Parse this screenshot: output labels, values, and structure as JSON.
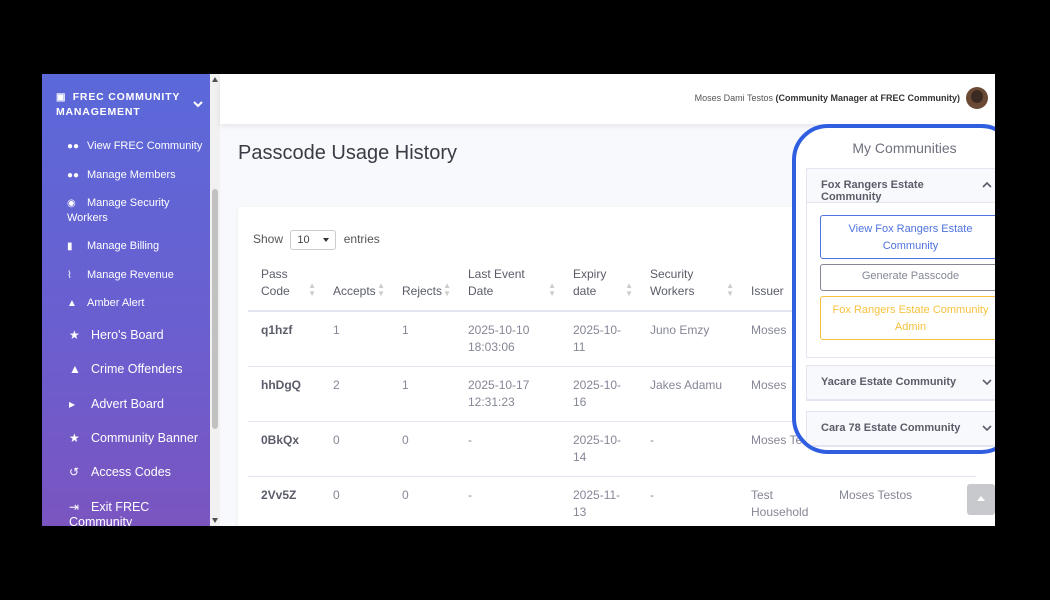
{
  "sidebar": {
    "brand": "FREC COMMUNITY MANAGEMENT",
    "items": [
      {
        "label": "View FREC Community",
        "icon": "users-icon",
        "glyph": "👥"
      },
      {
        "label": "Manage Members",
        "icon": "users-icon",
        "glyph": "👥"
      },
      {
        "label": "Manage Security Workers",
        "icon": "shield-icon",
        "glyph": "⛊"
      },
      {
        "label": "Manage Billing",
        "icon": "file-icon",
        "glyph": "▮"
      },
      {
        "label": "Manage Revenue",
        "icon": "chart-line-icon",
        "glyph": "⌇"
      },
      {
        "label": "Amber Alert",
        "icon": "warning-icon",
        "glyph": "▲"
      },
      {
        "label": "Hero's Board",
        "icon": "trophy-icon",
        "glyph": "🏆"
      },
      {
        "label": "Crime Offenders",
        "icon": "warning-icon",
        "glyph": "▲"
      },
      {
        "label": "Advert Board",
        "icon": "megaphone-icon",
        "glyph": "📢"
      },
      {
        "label": "Community Banner",
        "icon": "trophy-icon",
        "glyph": "🏆"
      },
      {
        "label": "Access Codes",
        "icon": "history-icon",
        "glyph": "↺"
      },
      {
        "label": "Exit FREC Community",
        "icon": "sign-out-icon",
        "glyph": "⇥"
      }
    ]
  },
  "topbar": {
    "user_name": "Moses Dami Testos",
    "user_role": "(Community Manager at FREC Community)"
  },
  "page": {
    "title": "Passcode Usage History"
  },
  "table": {
    "show_label": "Show",
    "entries_value": "10",
    "entries_label": "entries",
    "headers": [
      "Pass Code",
      "Accepts",
      "Rejects",
      "Last Event Date",
      "Expiry date",
      "Security Workers",
      "Issuer",
      ""
    ],
    "rows": [
      {
        "code": "q1hzf",
        "accepts": "1",
        "rejects": "1",
        "last_event": "2025-10-10 18:03:06",
        "expiry": "2025-10-11",
        "workers": "Juno Emzy",
        "issuer": "Moses",
        "extra": ""
      },
      {
        "code": "hhDgQ",
        "accepts": "2",
        "rejects": "1",
        "last_event": "2025-10-17 12:31:23",
        "expiry": "2025-10-16",
        "workers": "Jakes Adamu",
        "issuer": "Moses",
        "extra": ""
      },
      {
        "code": "0BkQx",
        "accepts": "0",
        "rejects": "0",
        "last_event": "-",
        "expiry": "2025-10-14",
        "workers": "-",
        "issuer": "Moses Tes",
        "extra": ""
      },
      {
        "code": "2Vv5Z",
        "accepts": "0",
        "rejects": "0",
        "last_event": "-",
        "expiry": "2025-11-13",
        "workers": "-",
        "issuer": "Test Household",
        "extra": "Moses Testos"
      }
    ]
  },
  "communities": {
    "title": "My Communities",
    "expanded": {
      "name": "Fox Rangers Estate Community",
      "view_label": "View Fox Rangers Estate Community",
      "generate_label": "Generate Passcode",
      "admin_label": "Fox Rangers Estate Community Admin"
    },
    "others": [
      "Yacare Estate Community",
      "Cara 78 Estate Community"
    ]
  },
  "colors": {
    "accent": "#4e73df",
    "highlight_border": "#2f5fe0",
    "warning": "#f6c23e"
  }
}
